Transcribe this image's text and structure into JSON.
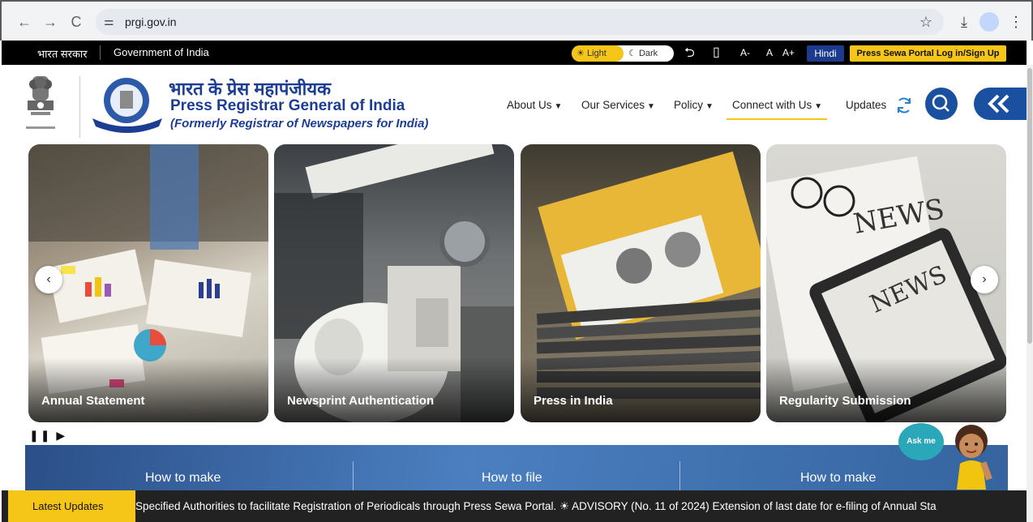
{
  "browser": {
    "url": "prgi.gov.in",
    "back_icon": "←",
    "forward_icon": "→",
    "reload_icon": "C",
    "site_info_icon": "⚌",
    "bookmark_icon": "☆",
    "download_icon": "⤓",
    "profile_icon": "👤",
    "menu_icon": "⋮"
  },
  "gov_strip": {
    "hindi_label": "भारत सरकार",
    "english_label": "Government of India",
    "light_label": "Light",
    "dark_label": "Dark",
    "font_decrease": "A-",
    "font_normal": "A",
    "font_increase": "A+",
    "language_button": "Hindi",
    "portal_button": "Press Sewa Portal Log in/Sign Up"
  },
  "header": {
    "org_name_hindi": "भारत के प्रेस महापंजीयक",
    "org_name_english": "Press Registrar General of India",
    "org_formerly": "(Formerly Registrar of Newspapers for India)",
    "menu": [
      {
        "label": "About Us"
      },
      {
        "label": "Our Services"
      },
      {
        "label": "Policy"
      },
      {
        "label": "Connect with Us"
      },
      {
        "label": "Updates"
      }
    ]
  },
  "carousel": {
    "slides": [
      {
        "caption": "Annual Statement"
      },
      {
        "caption": "Newsprint Authentication"
      },
      {
        "caption": "Press in India"
      },
      {
        "caption": "Regularity Submission"
      }
    ],
    "prev_icon": "‹",
    "next_icon": "›",
    "controls": "❚❚ ▶"
  },
  "howto": {
    "items": [
      "How to make",
      "How to file",
      "How to make"
    ]
  },
  "ticker": {
    "label": "Latest Updates",
    "text": "Specified Authorities to facilitate Registration of Periodicals through Press Sewa Portal.   ☀ ADVISORY (No. 11 of 2024) Extension of last date for e-filing of Annual Sta"
  },
  "assistant": {
    "label": "Ask me"
  },
  "colors": {
    "brand_blue": "#1b3d94",
    "accent_yellow": "#f5c518",
    "strip_black": "#000000"
  }
}
